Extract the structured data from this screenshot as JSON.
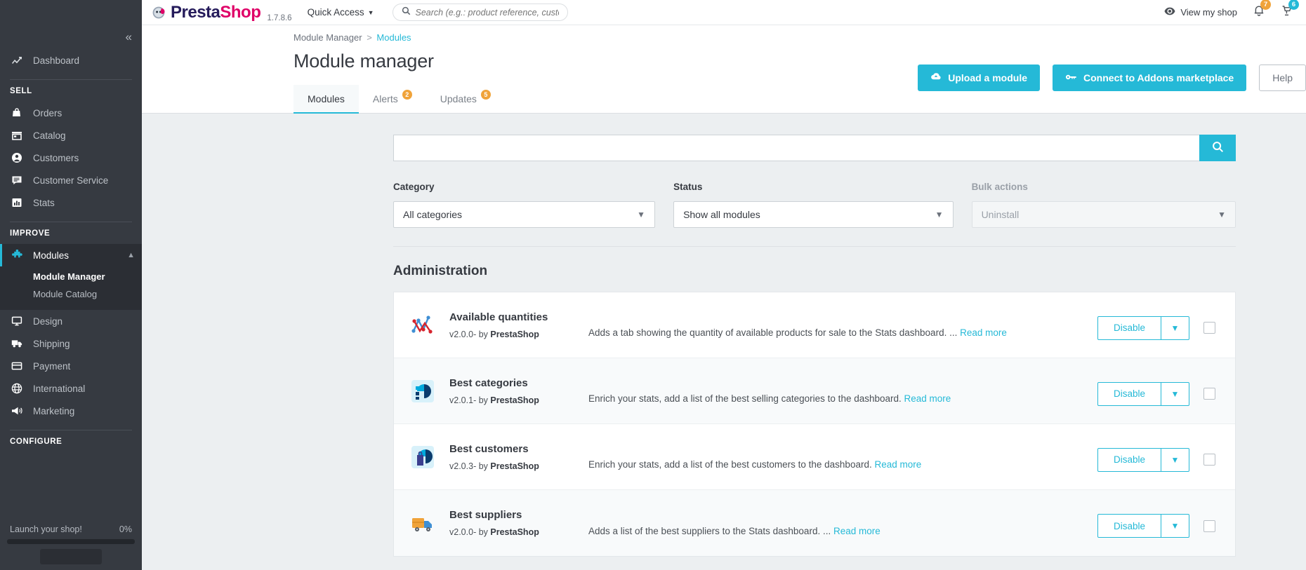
{
  "topbar": {
    "brand_a": "Presta",
    "brand_b": "Shop",
    "version": "1.7.8.6",
    "quick_access": "Quick Access",
    "search_placeholder": "Search (e.g.: product reference, custon",
    "search_value": "",
    "view_my_shop": "View my shop",
    "notifications_badge": "7",
    "cart_badge": "6"
  },
  "sidebar": {
    "dashboard": "Dashboard",
    "sell_title": "SELL",
    "sell_items": [
      {
        "label": "Orders",
        "icon": "basket-icon"
      },
      {
        "label": "Catalog",
        "icon": "store-icon"
      },
      {
        "label": "Customers",
        "icon": "person-icon"
      },
      {
        "label": "Customer Service",
        "icon": "chat-icon"
      },
      {
        "label": "Stats",
        "icon": "chart-icon"
      }
    ],
    "improve_title": "IMPROVE",
    "modules_label": "Modules",
    "modules_sub": [
      {
        "label": "Module Manager",
        "current": true
      },
      {
        "label": "Module Catalog",
        "current": false
      }
    ],
    "improve_items": [
      {
        "label": "Design",
        "icon": "monitor-icon"
      },
      {
        "label": "Shipping",
        "icon": "truck-icon"
      },
      {
        "label": "Payment",
        "icon": "card-icon"
      },
      {
        "label": "International",
        "icon": "globe-icon"
      },
      {
        "label": "Marketing",
        "icon": "megaphone-icon"
      }
    ],
    "configure_title": "CONFIGURE",
    "launch_label": "Launch your shop!",
    "launch_percent": "0%"
  },
  "header": {
    "breadcrumb_root": "Module Manager",
    "breadcrumb_sep": ">",
    "breadcrumb_current": "Modules",
    "title": "Module manager",
    "upload_button": "Upload a module",
    "connect_button": "Connect to Addons marketplace",
    "help_button": "Help"
  },
  "tabs": [
    {
      "label": "Modules",
      "badge": "",
      "active": true
    },
    {
      "label": "Alerts",
      "badge": "2",
      "active": false
    },
    {
      "label": "Updates",
      "badge": "5",
      "active": false
    }
  ],
  "filters": {
    "search_value": "",
    "search_placeholder": "",
    "category_label": "Category",
    "category_value": "All categories",
    "status_label": "Status",
    "status_value": "Show all modules",
    "bulk_label": "Bulk actions",
    "bulk_value": "Uninstall"
  },
  "section": {
    "title": "Administration"
  },
  "modules": [
    {
      "name": "Available quantities",
      "version": "v2.0.0",
      "by": "- by ",
      "author": "PrestaShop",
      "description": "Adds a tab showing the quantity of available products for sale to the Stats dashboard. ...",
      "read_more": "Read more",
      "action": "Disable",
      "icon": "line-chart-icon"
    },
    {
      "name": "Best categories",
      "version": "v2.0.1",
      "by": "- by ",
      "author": "PrestaShop",
      "description": "Enrich your stats, add a list of the best selling categories to the dashboard.",
      "read_more": "Read more",
      "action": "Disable",
      "icon": "categories-pie-icon"
    },
    {
      "name": "Best customers",
      "version": "v2.0.3",
      "by": "- by ",
      "author": "PrestaShop",
      "description": "Enrich your stats, add a list of the best customers to the dashboard.",
      "read_more": "Read more",
      "action": "Disable",
      "icon": "customers-pie-icon"
    },
    {
      "name": "Best suppliers",
      "version": "v2.0.0",
      "by": "- by ",
      "author": "PrestaShop",
      "description": "Adds a list of the best suppliers to the Stats dashboard. ...",
      "read_more": "Read more",
      "action": "Disable",
      "icon": "truck-box-icon"
    }
  ],
  "colors": {
    "accent": "#25b9d7",
    "sidebar": "#363a41",
    "badge_orange": "#f0a33a",
    "brand_pink": "#df0067"
  }
}
